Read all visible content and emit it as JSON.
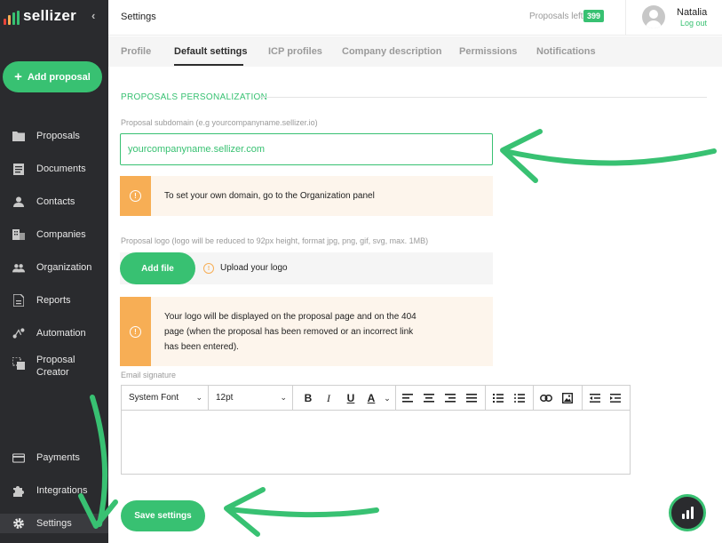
{
  "app": {
    "logo_text": "sellizer",
    "logo_colors": [
      "#e8443a",
      "#f7ae55",
      "#38c172",
      "#38c172"
    ]
  },
  "colors": {
    "accent": "#38c172",
    "sidebar_bg": "#2a2b2e",
    "notice_bar": "#f7ae55",
    "notice_bg": "#fdf5ec"
  },
  "sidebar": {
    "add_button": "Add proposal",
    "items": [
      {
        "label": "Proposals",
        "icon": "folder-icon"
      },
      {
        "label": "Documents",
        "icon": "document-icon"
      },
      {
        "label": "Contacts",
        "icon": "person-icon"
      },
      {
        "label": "Companies",
        "icon": "building-icon"
      },
      {
        "label": "Organization",
        "icon": "people-icon"
      },
      {
        "label": "Reports",
        "icon": "report-icon"
      },
      {
        "label": "Automation",
        "icon": "automation-icon"
      },
      {
        "label": "Proposal Creator",
        "icon": "creator-icon"
      },
      {
        "label": "Payments",
        "icon": "card-icon"
      },
      {
        "label": "Integrations",
        "icon": "puzzle-icon"
      },
      {
        "label": "Settings",
        "icon": "gear-icon",
        "active": true
      }
    ]
  },
  "header": {
    "title": "Settings",
    "proposals_left_label": "Proposals left",
    "proposals_left_count": "399",
    "user_name": "Natalia",
    "logout": "Log out"
  },
  "tabs": [
    {
      "label": "Profile"
    },
    {
      "label": "Default settings",
      "active": true
    },
    {
      "label": "ICP profiles"
    },
    {
      "label": "Company description"
    },
    {
      "label": "Permissions"
    },
    {
      "label": "Notifications"
    }
  ],
  "form": {
    "section_title": "PROPOSALS PERSONALIZATION",
    "subdomain_label": "Proposal subdomain (e.g yourcompanyname.sellizer.io)",
    "subdomain_placeholder": "yourcompanyname.sellizer.com",
    "domain_notice": "To set your own domain, go to the Organization panel",
    "logo_label": "Proposal logo (logo will be reduced to 92px height, format jpg, png, gif, svg, max. 1MB)",
    "add_file": "Add file",
    "upload_logo": "Upload your logo",
    "logo_notice_line1": "Your logo will be displayed on the proposal page and on the 404",
    "logo_notice_line2": "page (when the proposal has been removed or an incorrect link",
    "logo_notice_line3": "has been entered).",
    "email_signature_label": "Email signature",
    "font_family": "System Font",
    "font_size": "12pt",
    "save": "Save settings"
  }
}
